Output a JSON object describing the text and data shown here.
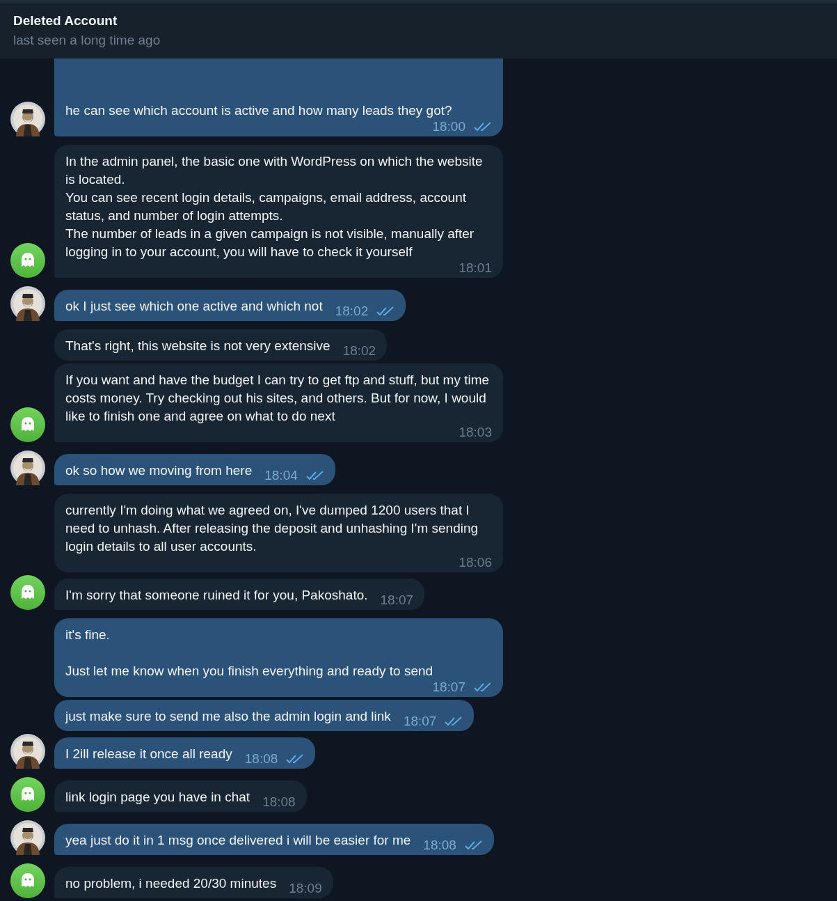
{
  "header": {
    "title": "Deleted Account",
    "status": "last seen a long time ago"
  },
  "messages": [
    {
      "kind": "out",
      "text": "he can see which account is active and how many leads they got?",
      "time": "18:00",
      "read": true,
      "avatar": true
    },
    {
      "kind": "in",
      "text": "In the admin panel, the basic one with WordPress on which the website is located.\nYou can see recent login details, campaigns, email address, account status, and number of login attempts.\nThe number of leads in a given campaign is not visible, manually after logging in to your account, you will have to check it yourself",
      "time": "18:01",
      "avatar": true
    },
    {
      "kind": "out",
      "text": "ok I just see which one active and which not",
      "time": "18:02",
      "read": true,
      "avatar": true
    },
    {
      "kind": "in",
      "text": "That's right, this website is not very extensive",
      "time": "18:02",
      "avatar": false
    },
    {
      "kind": "in",
      "text": "If you want and have the budget I can try to get ftp and stuff, but my time costs money. Try checking out his sites, and others. But for now, I would like to finish one and agree on what to do next",
      "time": "18:03",
      "avatar": true
    },
    {
      "kind": "out",
      "text": "ok so how we moving from here",
      "time": "18:04",
      "read": true,
      "avatar": true
    },
    {
      "kind": "in",
      "text": "currently I'm doing what we agreed on, I've dumped 1200 users that I need to unhash. After releasing the deposit and unhashing I'm sending login details to all user accounts.",
      "time": "18:06",
      "avatar": false
    },
    {
      "kind": "in",
      "text": "I'm sorry that someone ruined it for you, Pakoshato.",
      "time": "18:07",
      "avatar": true
    },
    {
      "kind": "out",
      "text": "it's fine.\n\nJust let me know when you finish everything and ready to send",
      "time": "18:07",
      "read": true,
      "avatar": false
    },
    {
      "kind": "out",
      "text": "just make sure to send me also the admin login and link",
      "time": "18:07",
      "read": true,
      "avatar": false
    },
    {
      "kind": "out",
      "text": "I 2ill release it once all ready",
      "time": "18:08",
      "read": true,
      "avatar": true
    },
    {
      "kind": "in",
      "text": "link login page you have in chat",
      "time": "18:08",
      "avatar": true
    },
    {
      "kind": "out",
      "text": "yea just do it in 1 msg once delivered i will be easier for me",
      "time": "18:08",
      "read": true,
      "avatar": true
    },
    {
      "kind": "in",
      "text": "no problem, i needed 20/30 minutes",
      "time": "18:09",
      "avatar": true
    }
  ]
}
